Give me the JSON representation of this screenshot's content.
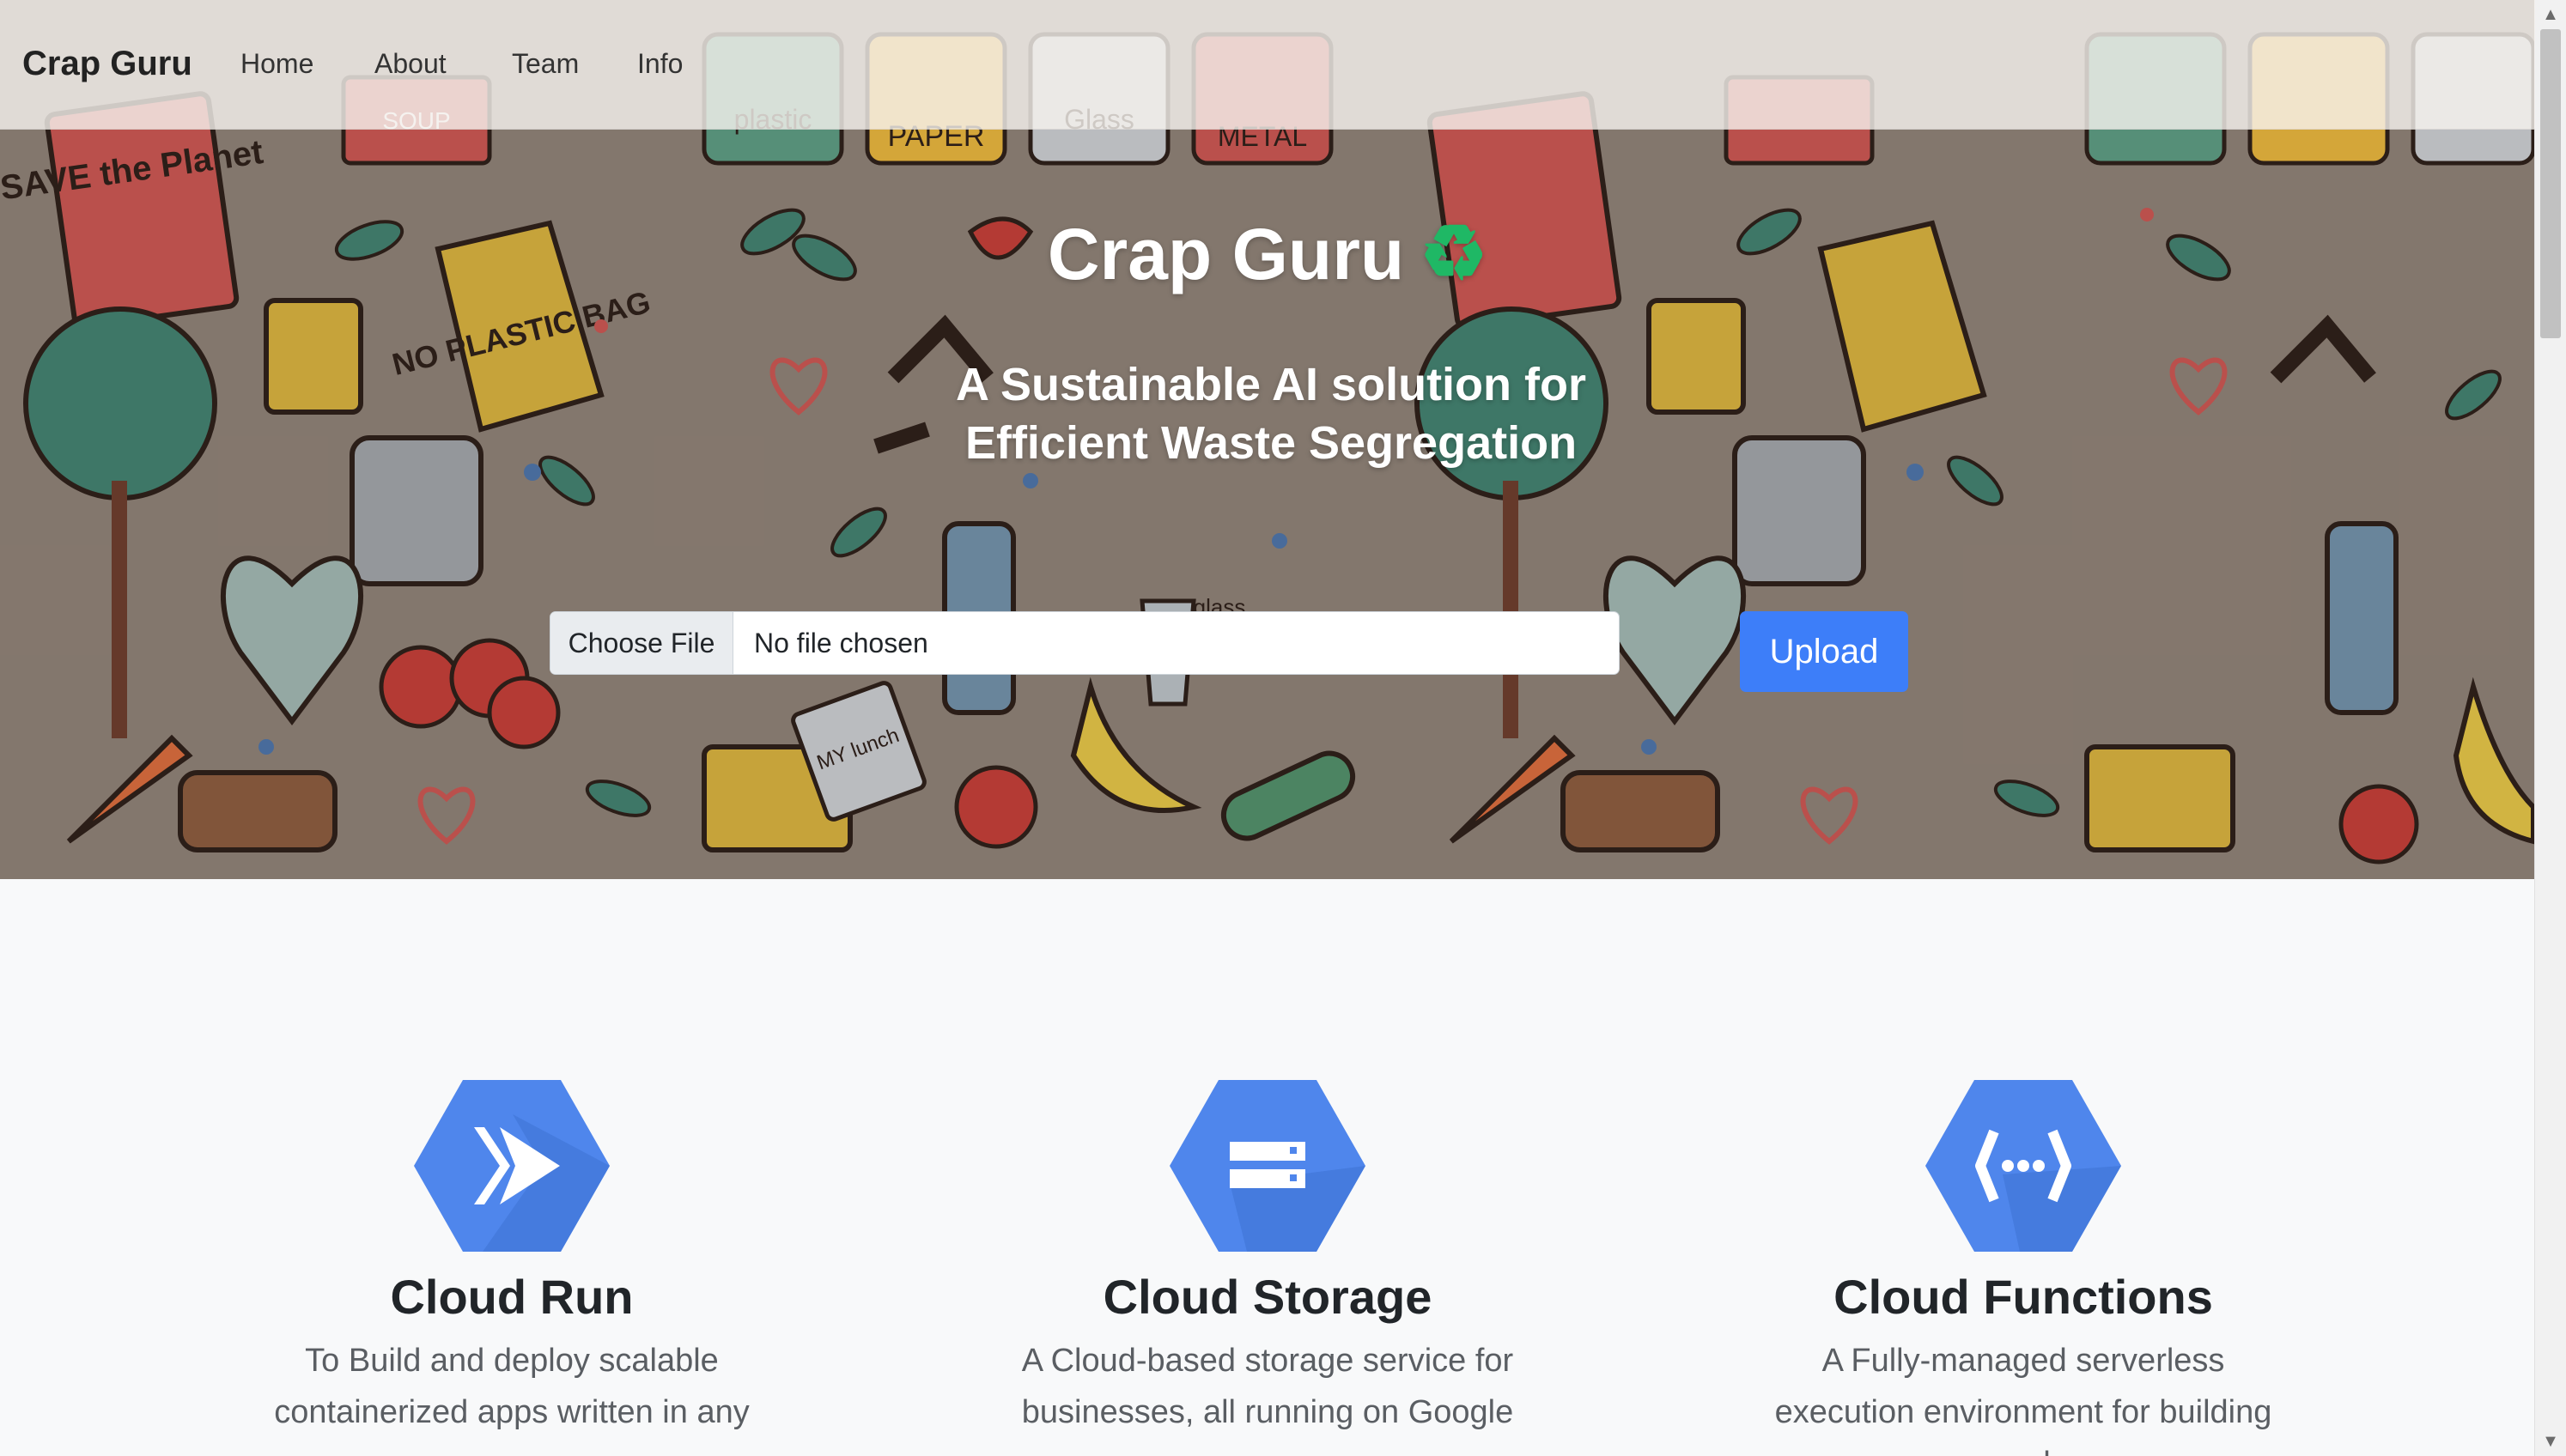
{
  "navbar": {
    "brand": "Crap Guru",
    "links": [
      "Home",
      "About",
      "Team",
      "Info"
    ]
  },
  "hero": {
    "title": "Crap Guru",
    "title_icon": "recycle-icon",
    "subtitle_line1": "A Sustainable AI solution for",
    "subtitle_line2": "Efficient Waste Segregation",
    "background_art_labels": [
      "SAVE the Planet",
      "NO PLASTIC BAG",
      "SOUP",
      "plastic",
      "PAPER",
      "Glass",
      "METAL",
      "MY lunch",
      "glass"
    ]
  },
  "upload_form": {
    "choose_file_label": "Choose File",
    "file_status": "No file chosen",
    "upload_label": "Upload"
  },
  "features": [
    {
      "icon": "cloud-run-icon",
      "title": "Cloud Run",
      "text": "To Build and deploy scalable containerized apps written in any"
    },
    {
      "icon": "cloud-storage-icon",
      "title": "Cloud Storage",
      "text": "A Cloud-based storage service for businesses, all running on Google"
    },
    {
      "icon": "cloud-functions-icon",
      "title": "Cloud Functions",
      "text": "A Fully-managed serverless execution environment for building and"
    }
  ],
  "colors": {
    "hero_background": "#8c7f74",
    "upload_button": "#3d7ef9",
    "gcp_icon_blue": "#4f86ec",
    "recycle_green": "#1fb865",
    "page_background": "#f8f9fa"
  }
}
